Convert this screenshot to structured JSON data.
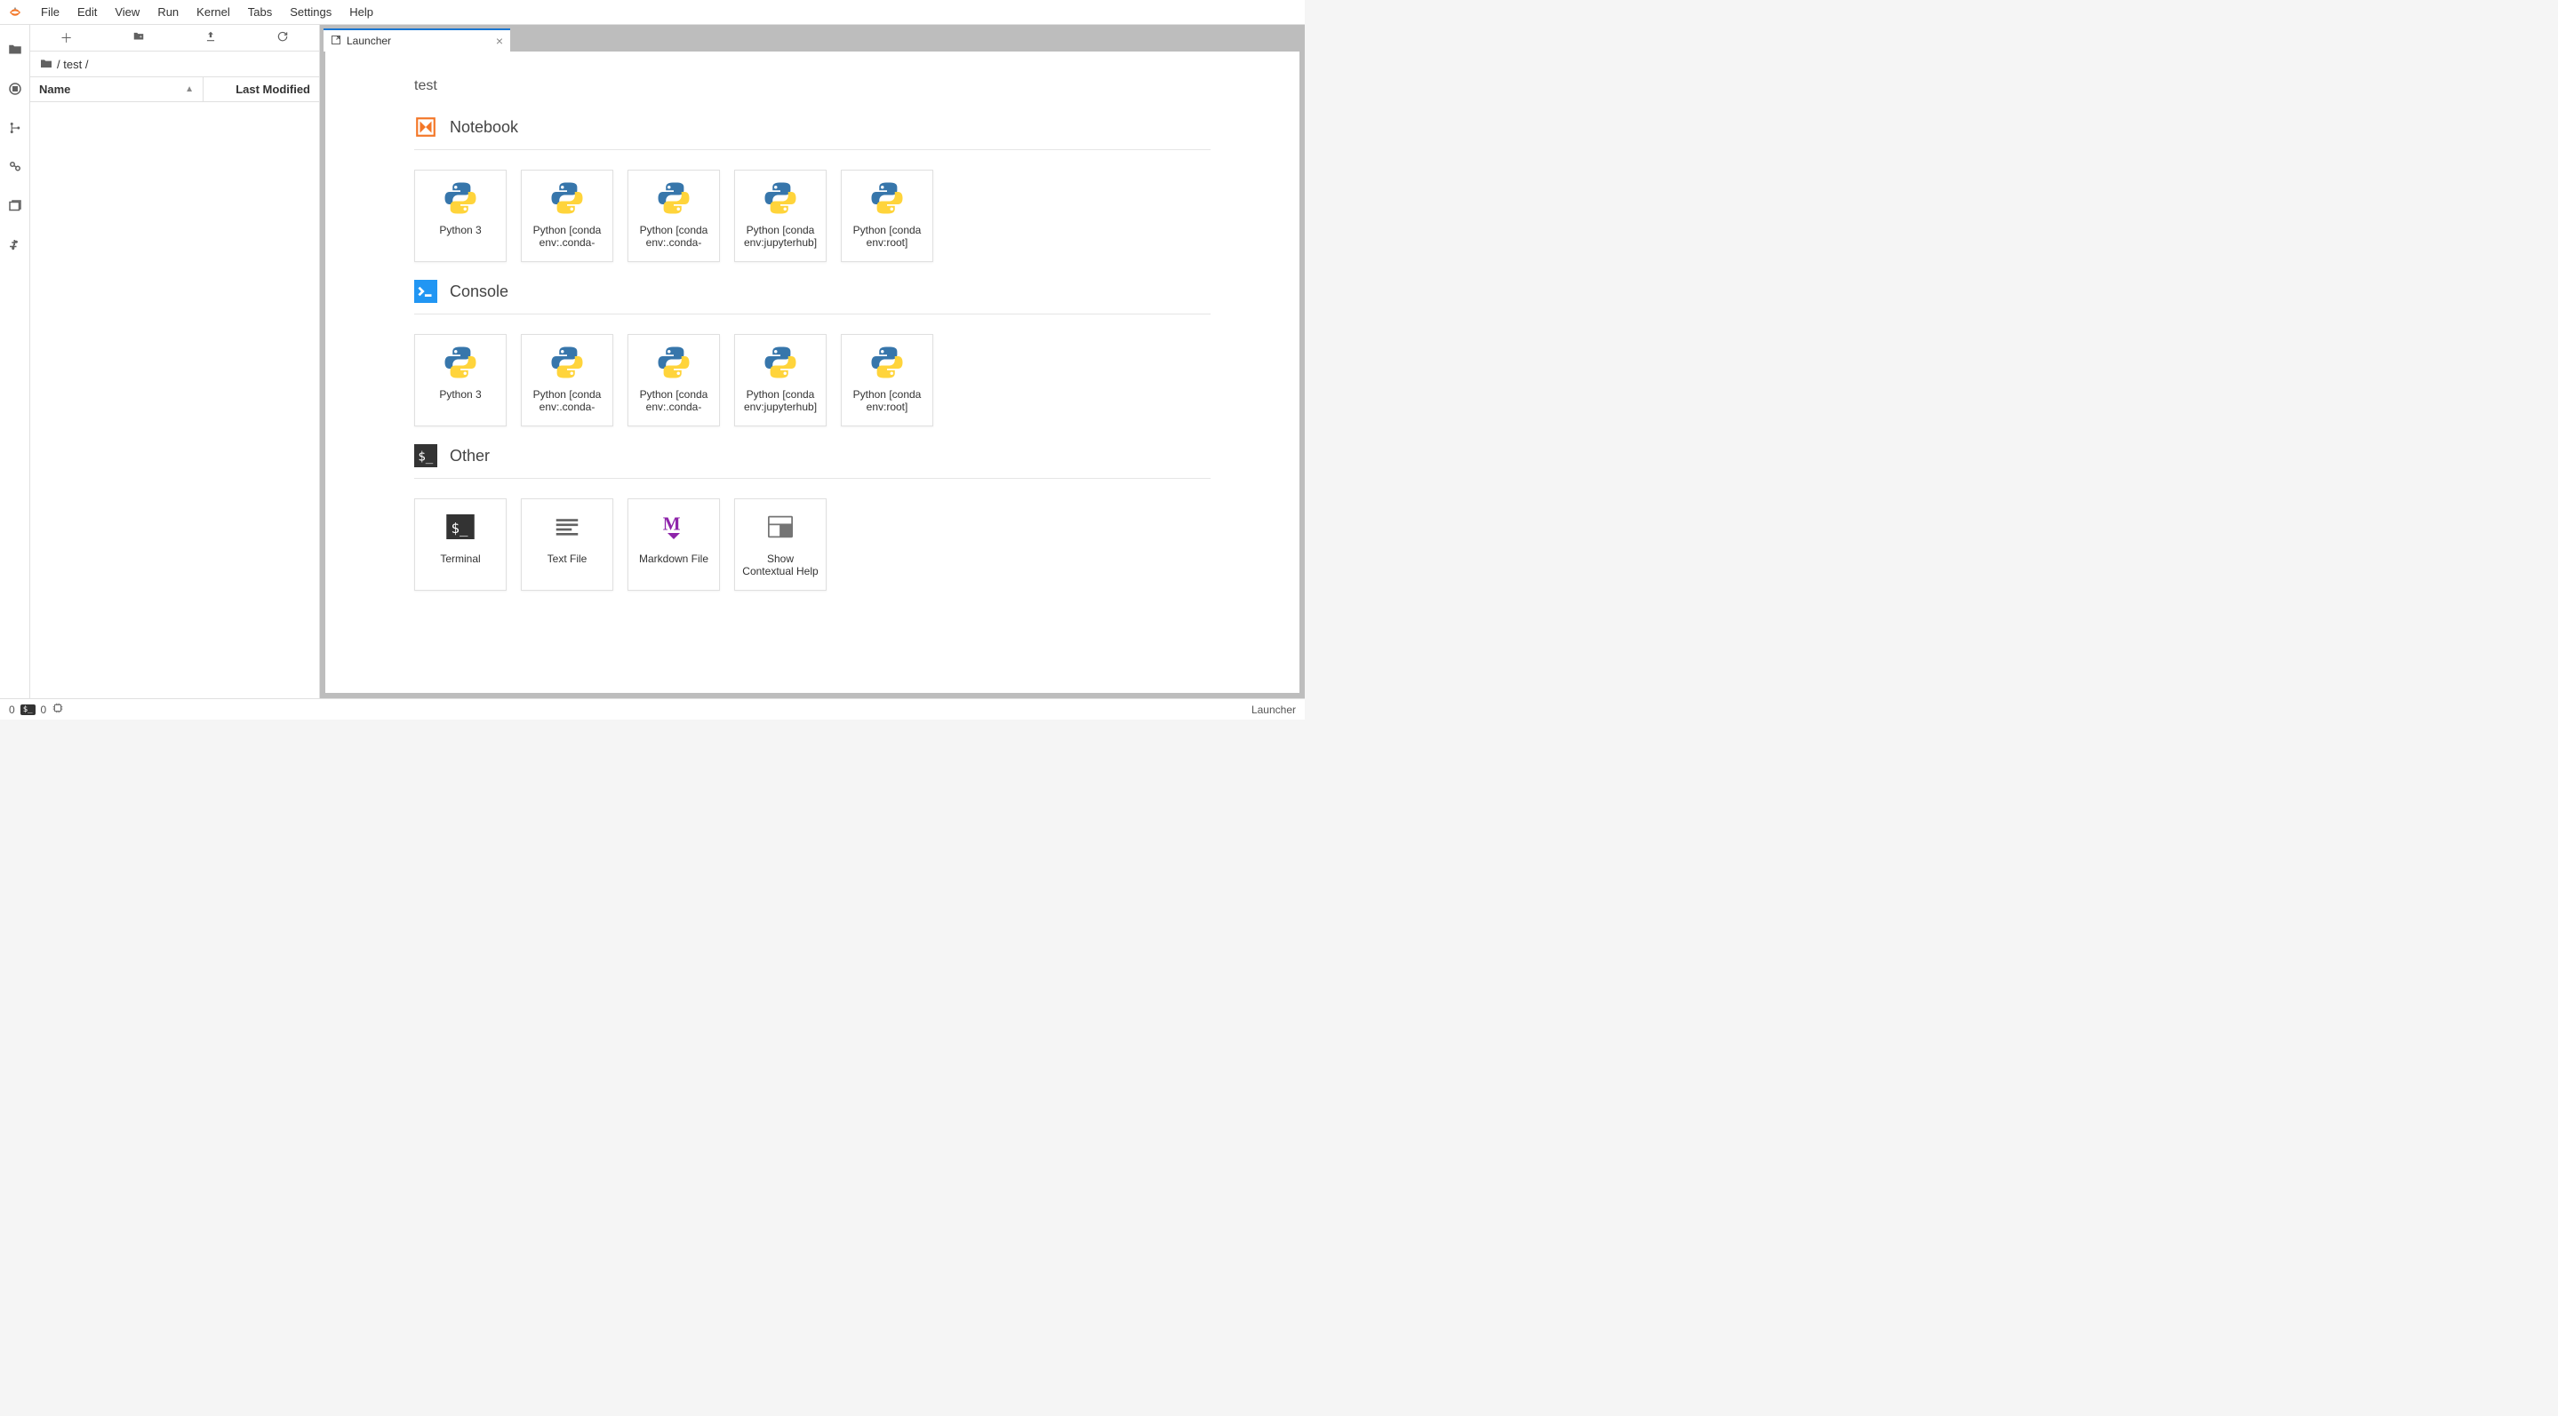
{
  "menu": {
    "items": [
      "File",
      "Edit",
      "View",
      "Run",
      "Kernel",
      "Tabs",
      "Settings",
      "Help"
    ]
  },
  "file_browser": {
    "breadcrumb_root": "/",
    "breadcrumb_folder": "test",
    "breadcrumb_trail_sep": "/",
    "header_name": "Name",
    "header_modified": "Last Modified"
  },
  "tab": {
    "label": "Launcher"
  },
  "launcher": {
    "cwd": "test",
    "sections": [
      {
        "title": "Notebook",
        "icon": "notebook",
        "cards": [
          {
            "label": "Python 3",
            "icon": "python"
          },
          {
            "label": "Python [conda env:.conda-",
            "icon": "python"
          },
          {
            "label": "Python [conda env:.conda-",
            "icon": "python"
          },
          {
            "label": "Python [conda env:jupyterhub]",
            "icon": "python"
          },
          {
            "label": "Python [conda env:root]",
            "icon": "python"
          }
        ]
      },
      {
        "title": "Console",
        "icon": "console",
        "cards": [
          {
            "label": "Python 3",
            "icon": "python"
          },
          {
            "label": "Python [conda env:.conda-",
            "icon": "python"
          },
          {
            "label": "Python [conda env:.conda-",
            "icon": "python"
          },
          {
            "label": "Python [conda env:jupyterhub]",
            "icon": "python"
          },
          {
            "label": "Python [conda env:root]",
            "icon": "python"
          }
        ]
      },
      {
        "title": "Other",
        "icon": "terminal",
        "cards": [
          {
            "label": "Terminal",
            "icon": "terminal-card"
          },
          {
            "label": "Text File",
            "icon": "textfile"
          },
          {
            "label": "Markdown File",
            "icon": "markdown"
          },
          {
            "label": "Show Contextual Help",
            "icon": "contexthelp"
          }
        ]
      }
    ]
  },
  "status": {
    "left_count_a": "0",
    "left_count_b": "0",
    "right_label": "Launcher"
  }
}
